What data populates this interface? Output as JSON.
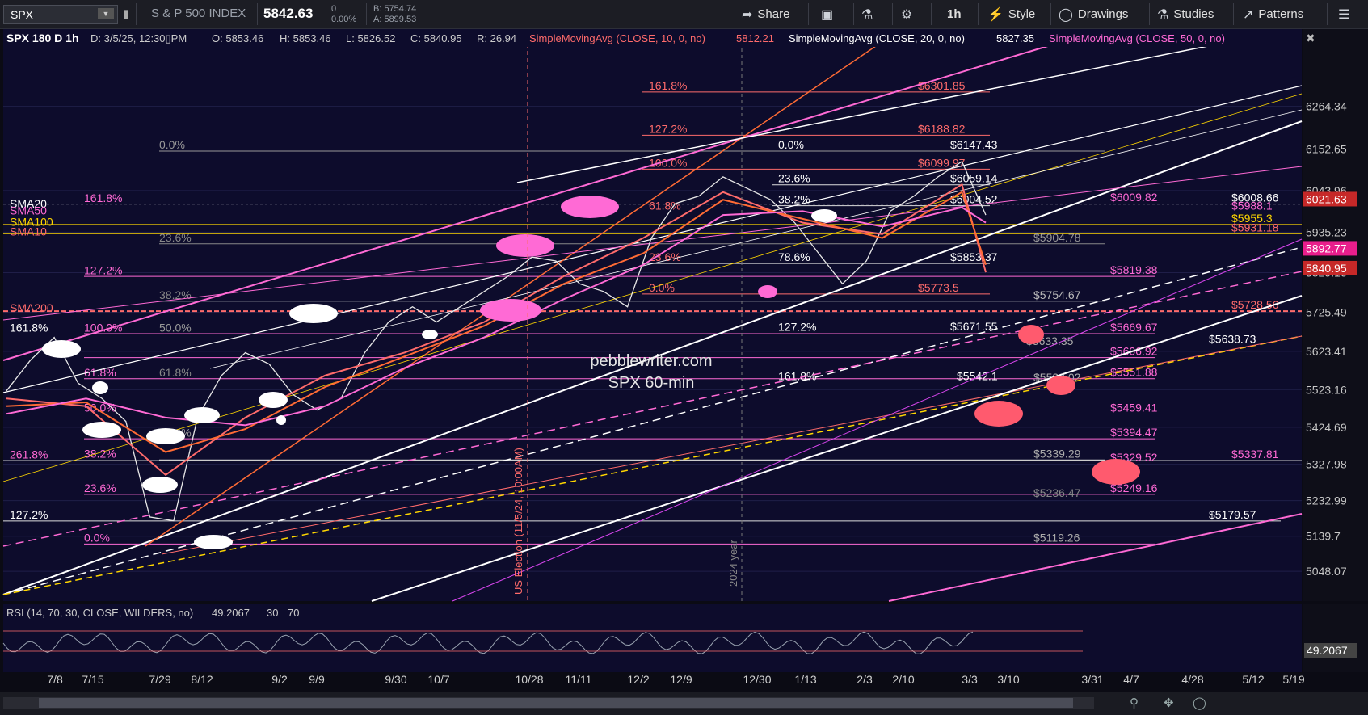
{
  "toolbar": {
    "symbol": "SPX",
    "index_name": "S & P 500 INDEX",
    "price": "5842.63",
    "change": "0",
    "change_pct": "0.00%",
    "bid": "B: 5754.74",
    "ask": "A: 5899.53",
    "share": "Share",
    "interval": "1h",
    "style": "Style",
    "drawings": "Drawings",
    "studies": "Studies",
    "patterns": "Patterns"
  },
  "study_bar": {
    "title": "SPX 180 D 1h",
    "date": "D: 3/5/25, 12:30▯PM",
    "open": "O: 5853.46",
    "high": "H: 5853.46",
    "low": "L: 5826.52",
    "close": "C: 5840.95",
    "range": "R: 26.94",
    "sma10_label": "SimpleMovingAvg (CLOSE, 10, 0, no)",
    "sma10_value": "5812.21",
    "sma20_label": "SimpleMovingAvg (CLOSE, 20, 0, no)",
    "sma20_value": "5827.35",
    "sma50_label": "SimpleMovingAvg (CLOSE, 50, 0, no)"
  },
  "rsi_bar": {
    "label": "RSI (14, 70, 30, CLOSE, WILDERS, no)",
    "value": "49.2067",
    "lower": "30",
    "upper": "70"
  },
  "colors": {
    "background": "#0d0c2c",
    "price_line": "#e8e8e8",
    "fib_magenta": "#ff6ad5",
    "fib_red": "#ff6b6b",
    "sma_orange": "#ff6b35",
    "sma_yellow": "#ffd700"
  },
  "chart_data": {
    "type": "line",
    "title": "pebblewriter.com",
    "subtitle": "SPX 60-min",
    "x_tick_labels": [
      "7/8",
      "7/15",
      "7/29",
      "8/12",
      "9/2",
      "9/9",
      "9/30",
      "10/7",
      "10/28",
      "11/11",
      "12/2",
      "12/9",
      "12/30",
      "1/13",
      "2/3",
      "2/10",
      "3/3",
      "3/10",
      "3/31",
      "4/7",
      "4/28",
      "5/12",
      "5/19"
    ],
    "y_tick_labels": [
      "6264.34",
      "6152.65",
      "6043.96",
      "5935.23",
      "5829.16",
      "5725.49",
      "5623.41",
      "5523.16",
      "5424.69",
      "5327.98",
      "5232.99",
      "5139.7",
      "5048.07"
    ],
    "ylim": [
      4970,
      6420
    ],
    "price_badges": {
      "badge_1": "6021.63",
      "badge_2": "5892.77",
      "badge_3": "5840.95",
      "rsi": "49.2067"
    },
    "sma_labels": [
      "SMA20",
      "SMA50",
      "SMA100",
      "SMA10",
      "SMA200"
    ],
    "event_labels": [
      "US Election (11/5/24, 10:00AM)",
      "2024 year"
    ],
    "fib_pct_labels": [
      "161.8%",
      "127.2%",
      "100.0%",
      "0.0%",
      "23.6%",
      "38.2%",
      "61.8%",
      "78.6%",
      "50.0%",
      "261.8%"
    ],
    "fib_price_labels": [
      "$6301.85",
      "$6188.82",
      "$6147.43",
      "$6099.97",
      "$6059.14",
      "$6004.52",
      "$6009.82",
      "$6008.66",
      "$5988.1",
      "$5955.3",
      "$5931.18",
      "$5904.78",
      "$5853.37",
      "$5819.38",
      "$5773.5",
      "$5754.67",
      "$5728.56",
      "$5671.55",
      "$5669.67",
      "$5638.73",
      "$5633.35",
      "$5606.92",
      "$5551.88",
      "$5542.1",
      "$5539.02",
      "$5459.41",
      "$5394.47",
      "$5339.29",
      "$5329.52",
      "$5337.81",
      "$5249.16",
      "$5236.47",
      "$5179.57",
      "$5119.26"
    ],
    "series": [
      {
        "name": "SPX",
        "x": [
          0,
          6,
          12,
          18,
          24,
          30,
          36,
          42,
          48,
          54,
          60,
          66,
          72,
          78,
          84,
          90,
          96,
          102,
          108,
          114,
          120,
          126,
          132,
          138,
          144,
          150,
          156,
          162,
          168,
          174,
          180,
          186,
          192,
          198,
          204,
          210,
          216,
          222,
          228,
          234,
          240,
          246
        ],
        "values": [
          5520,
          5600,
          5660,
          5540,
          5500,
          5440,
          5190,
          5180,
          5450,
          5560,
          5620,
          5590,
          5510,
          5470,
          5500,
          5620,
          5700,
          5740,
          5700,
          5740,
          5780,
          5820,
          5870,
          5860,
          5800,
          5780,
          5740,
          5920,
          6010,
          6030,
          6080,
          6050,
          6020,
          5960,
          5880,
          5800,
          5860,
          5990,
          6030,
          6080,
          6120,
          5980
        ]
      },
      {
        "name": "SMA10",
        "x": [
          0,
          20,
          40,
          60,
          80,
          100,
          120,
          140,
          160,
          180,
          200,
          220,
          240,
          246
        ],
        "values": [
          5500,
          5480,
          5300,
          5450,
          5560,
          5620,
          5700,
          5820,
          5920,
          6040,
          5960,
          5930,
          6060,
          5830
        ]
      },
      {
        "name": "SMA20",
        "x": [
          0,
          20,
          40,
          60,
          80,
          100,
          120,
          140,
          160,
          180,
          200,
          220,
          240,
          246
        ],
        "values": [
          5480,
          5490,
          5360,
          5420,
          5530,
          5610,
          5690,
          5800,
          5880,
          6020,
          5970,
          5920,
          6040,
          5850
        ]
      },
      {
        "name": "SMA50",
        "x": [
          0,
          20,
          40,
          60,
          80,
          100,
          120,
          140,
          160,
          180,
          200,
          220,
          240,
          246
        ],
        "values": [
          5460,
          5500,
          5450,
          5430,
          5480,
          5580,
          5660,
          5760,
          5850,
          5980,
          5990,
          5950,
          6000,
          5960
        ]
      },
      {
        "name": "SMA200",
        "x": [
          0,
          246
        ],
        "values": [
          5728,
          5728
        ]
      }
    ]
  }
}
